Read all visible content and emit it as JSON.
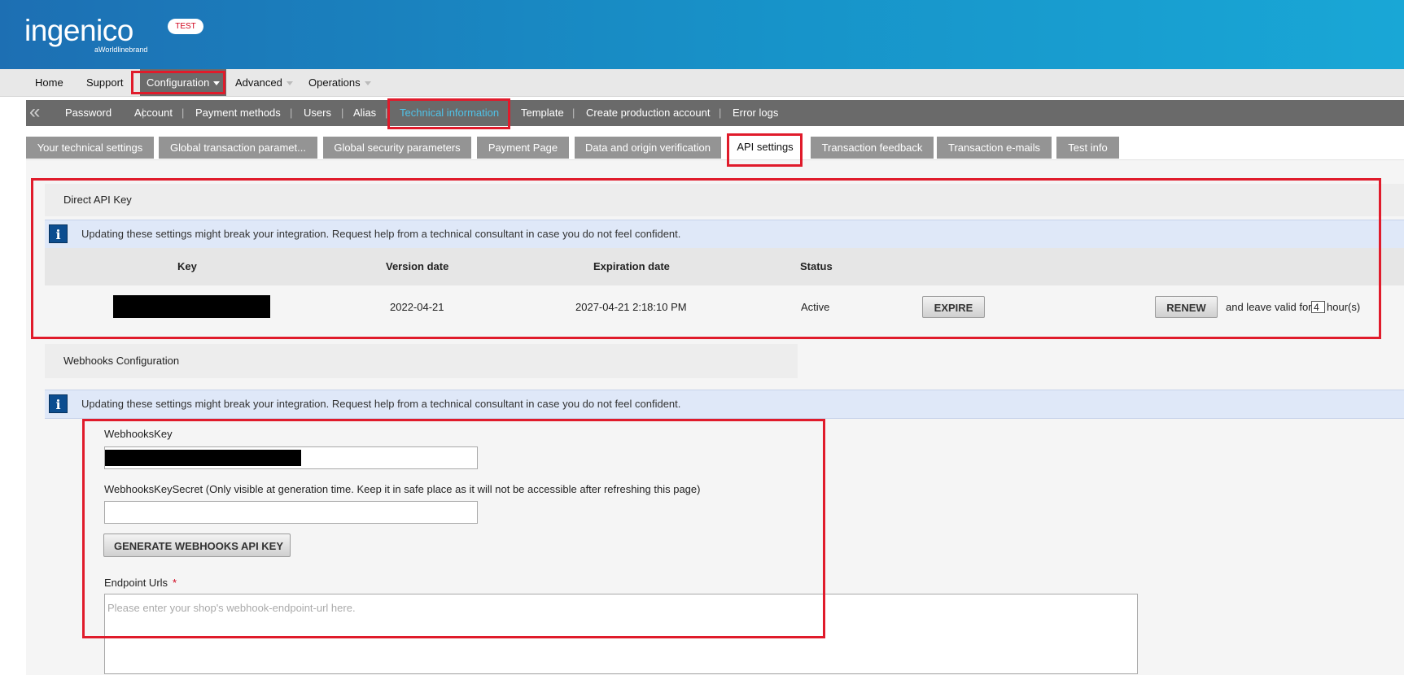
{
  "brand": {
    "logo_text": "ingenico",
    "logo_sub": "aWorldlinebrand",
    "env_badge": "TEST"
  },
  "top_nav": {
    "home": "Home",
    "support": "Support",
    "configuration": "Configuration",
    "advanced": "Advanced",
    "operations": "Operations"
  },
  "sub_nav": {
    "items": [
      "Password",
      "Account",
      "Payment methods",
      "Users",
      "Alias",
      "Technical information",
      "Template",
      "Create production account",
      "Error logs"
    ],
    "selected": "Technical information"
  },
  "tabs": {
    "items": [
      "Your technical settings",
      "Global transaction paramet...",
      "Global security parameters",
      "Payment Page",
      "Data and origin verification",
      "API settings",
      "Transaction feedback",
      "Transaction e-mails",
      "Test info"
    ],
    "selected": "API settings"
  },
  "direct_api": {
    "title": "Direct API Key",
    "info": "Updating these settings might break your integration. Request help from a technical consultant in case you do not feel confident.",
    "columns": [
      "Key",
      "Version date",
      "Expiration date",
      "Status"
    ],
    "row": {
      "version_date": "2022-04-21",
      "expiration_date": "2027-04-21 2:18:10 PM",
      "status": "Active"
    },
    "expire_label": "EXPIRE",
    "renew_label": "RENEW",
    "leave_valid_prefix": "and leave valid for",
    "hours_value": "4",
    "hours_suffix": "hour(s)"
  },
  "webhooks": {
    "title": "Webhooks Configuration",
    "info": "Updating these settings might break your integration. Request help from a technical consultant in case you do not feel confident.",
    "key_label": "WebhooksKey",
    "secret_label": "WebhooksKeySecret (Only visible at generation time. Keep it in safe place as it will not be accessible after refreshing this page)",
    "generate_label": "GENERATE WEBHOOKS API KEY",
    "endpoint_label": "Endpoint Urls",
    "required_mark": "*",
    "endpoint_placeholder": "Please enter your shop's webhook-endpoint-url here."
  },
  "colors": {
    "header_start": "#1d6fb3",
    "header_end": "#19a7d6",
    "highlight": "#e01b2b",
    "selected_link": "#4fc3e8"
  }
}
